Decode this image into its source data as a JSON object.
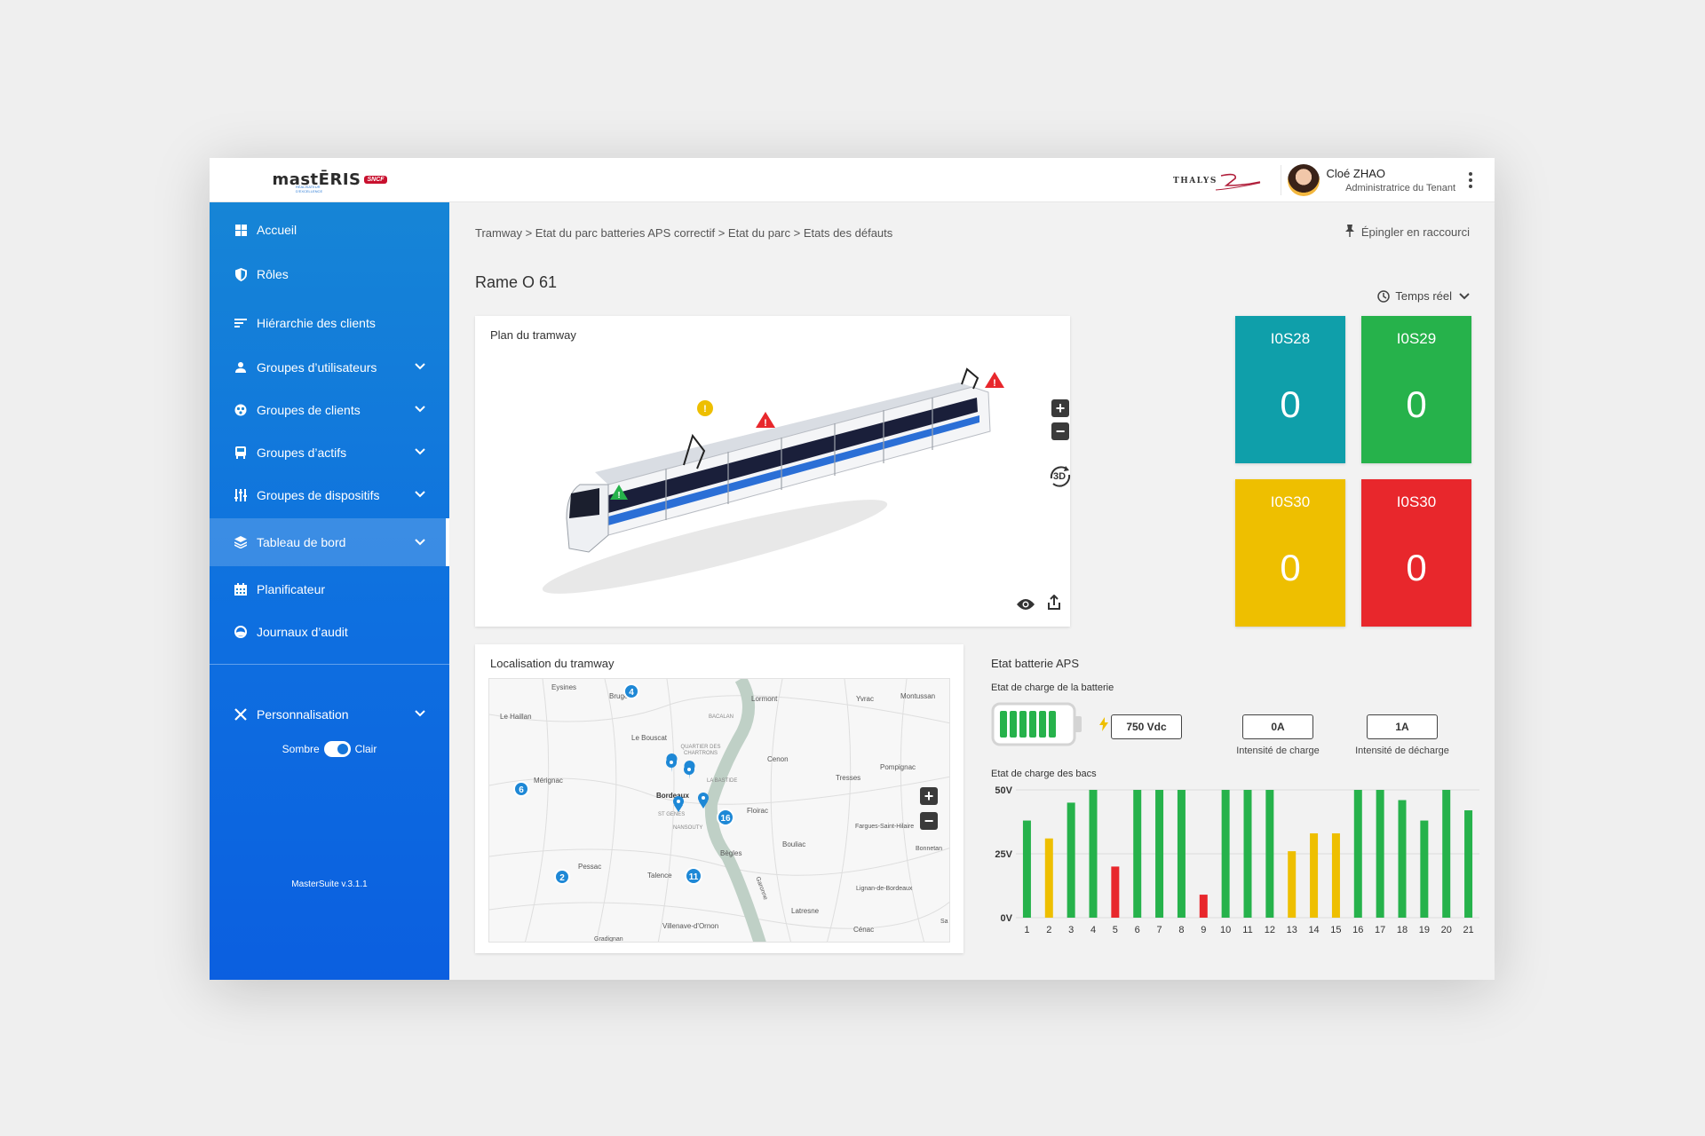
{
  "brand": {
    "logo": "mastĒRIS",
    "badge": "SNCF",
    "tagline_1": "RÉALISATEUR",
    "tagline_2": "D'EXCELLENCE",
    "partner_logo": "THALYS"
  },
  "user": {
    "name": "Cloé ZHAO",
    "role": "Administratrice du Tenant"
  },
  "sidebar": {
    "items": [
      {
        "label": "Accueil",
        "icon": "grid-icon"
      },
      {
        "label": "Rôles",
        "icon": "shield-icon"
      },
      {
        "label": "Hiérarchie des clients",
        "icon": "hierarchy-icon"
      },
      {
        "label": "Groupes d’utilisateurs",
        "icon": "user-group-icon"
      },
      {
        "label": "Groupes de clients",
        "icon": "client-group-icon"
      },
      {
        "label": "Groupes d’actifs",
        "icon": "asset-group-icon"
      },
      {
        "label": "Groupes de dispositifs",
        "icon": "sliders-icon"
      },
      {
        "label": "Tableau de bord",
        "icon": "layers-icon"
      },
      {
        "label": "Planificateur",
        "icon": "calendar-icon"
      },
      {
        "label": "Journaux d’audit",
        "icon": "audit-icon"
      }
    ],
    "personalisation": "Personnalisation",
    "theme_dark": "Sombre",
    "theme_light": "Clair",
    "version": "MasterSuite v.3.1.1"
  },
  "breadcrumb": "Tramway > Etat du parc batteries APS correctif > Etat du parc > Etats des défauts",
  "pin_label": "Épingler en raccourci",
  "page_title": "Rame O 61",
  "time_mode": "Temps réel",
  "tram_card": {
    "title": "Plan du tramway",
    "view_3d": "3D"
  },
  "tiles": [
    {
      "label": "I0S28",
      "value": "0",
      "color": "#0f9faa"
    },
    {
      "label": "I0S29",
      "value": "0",
      "color": "#26b24b"
    },
    {
      "label": "I0S30",
      "value": "0",
      "color": "#eebf00"
    },
    {
      "label": "I0S30",
      "value": "0",
      "color": "#e8272c"
    }
  ],
  "map_card": {
    "title": "Localisation du tramway",
    "places": [
      "Eysines",
      "Bruges",
      "Lormont",
      "Yvrac",
      "Montussan",
      "Le Haillan",
      "BACALAN",
      "Le Bouscat",
      "QUARTIER DES CHARTRONS",
      "Cenon",
      "Pompignac",
      "Mérignac",
      "LA BASTIDE",
      "Tresses",
      "Bordeaux",
      "Floirac",
      "ST GENES",
      "NANSOUTY",
      "Fargues-Saint-Hilaire",
      "Bègles",
      "Bouliac",
      "Bonnetan",
      "Pessac",
      "Talence",
      "Lignan-de-Bordeaux",
      "Latresne",
      "Cénac",
      "Villenave-d'Ornon",
      "Gradignan",
      "Garonne",
      "Sa"
    ],
    "clusters": [
      "4",
      "6",
      "16",
      "2",
      "11"
    ]
  },
  "aps": {
    "title": "Etat batterie APS",
    "charge_title": "Etat de charge de la batterie",
    "voltage": "750 Vdc",
    "charge_current": "0A",
    "charge_current_label": "Intensité de charge",
    "discharge_current": "1A",
    "discharge_current_label": "Intensité de décharge",
    "bacs_title": "Etat de charge des bacs"
  },
  "colors": {
    "ok": "#26b24b",
    "warn": "#eebf00",
    "fault": "#e8272c",
    "accent": "#1685d6"
  },
  "chart_data": {
    "type": "bar",
    "title": "Etat de charge des bacs",
    "categories": [
      "1",
      "2",
      "3",
      "4",
      "5",
      "6",
      "7",
      "8",
      "9",
      "10",
      "11",
      "12",
      "13",
      "14",
      "15",
      "16",
      "17",
      "18",
      "19",
      "20",
      "21"
    ],
    "values": [
      38,
      31,
      45,
      50,
      20,
      50,
      50,
      50,
      9,
      50,
      50,
      50,
      26,
      33,
      33,
      50,
      50,
      46,
      38,
      50,
      42
    ],
    "status": [
      "ok",
      "warn",
      "ok",
      "ok",
      "fault",
      "ok",
      "ok",
      "ok",
      "fault",
      "ok",
      "ok",
      "ok",
      "warn",
      "warn",
      "warn",
      "ok",
      "ok",
      "ok",
      "ok",
      "ok",
      "ok"
    ],
    "yticks": [
      "0V",
      "25V",
      "50V"
    ],
    "ylim": [
      0,
      50
    ]
  }
}
